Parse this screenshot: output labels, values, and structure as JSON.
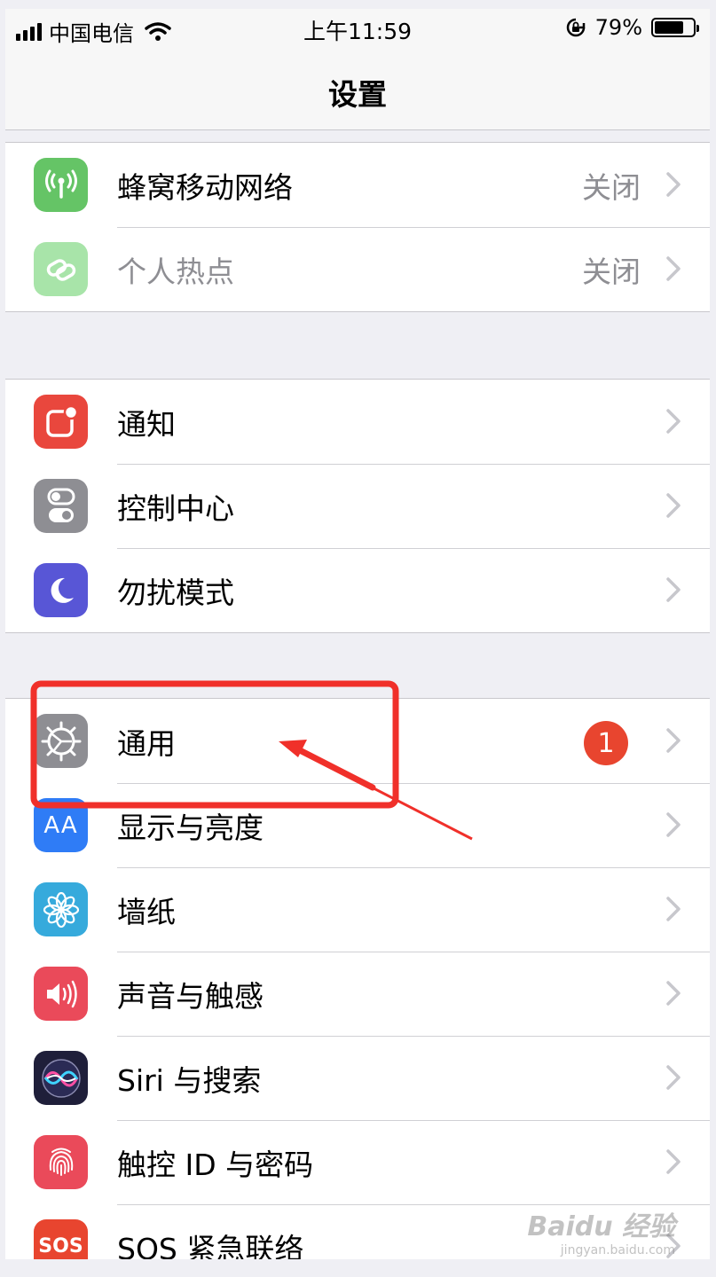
{
  "status_bar": {
    "carrier": "中国电信",
    "time": "上午11:59",
    "battery": "79%",
    "battery_level": 0.79
  },
  "nav": {
    "title": "设置"
  },
  "groups": [
    {
      "rows": [
        {
          "label": "蜂窝移动网络",
          "detail": "关闭",
          "icon": "antenna-icon",
          "color": "#65c466"
        },
        {
          "label": "个人热点",
          "detail": "关闭",
          "icon": "hotspot-link-icon",
          "color": "#a8e4a9",
          "dim": true
        }
      ]
    },
    {
      "rows": [
        {
          "label": "通知",
          "icon": "notifications-icon",
          "color": "#e9473d"
        },
        {
          "label": "控制中心",
          "icon": "control-center-icon",
          "color": "#8e8e93"
        },
        {
          "label": "勿扰模式",
          "icon": "moon-icon",
          "color": "#5856d6"
        }
      ]
    },
    {
      "rows": [
        {
          "label": "通用",
          "badge": "1",
          "icon": "gear-icon",
          "color": "#8e8e93"
        },
        {
          "label": "显示与亮度",
          "icon": "text-size-icon",
          "icon_text": "AA",
          "color": "#2f7cf6"
        },
        {
          "label": "墙纸",
          "icon": "flower-icon",
          "color": "#36aadc"
        },
        {
          "label": "声音与触感",
          "icon": "speaker-icon",
          "color": "#ea4a5a"
        },
        {
          "label": "Siri 与搜索",
          "icon": "siri-icon",
          "color": "#1f1f3a"
        },
        {
          "label": "触控 ID 与密码",
          "icon": "fingerprint-icon",
          "color": "#ea4a5a"
        },
        {
          "label": "SOS 紧急联络",
          "icon": "sos-icon",
          "icon_text": "SOS",
          "color": "#e8452f"
        }
      ]
    }
  ],
  "annotation": {
    "color": "#f0302a"
  },
  "watermark": {
    "brand": "Baidu 经验",
    "url": "jingyan.baidu.com"
  }
}
